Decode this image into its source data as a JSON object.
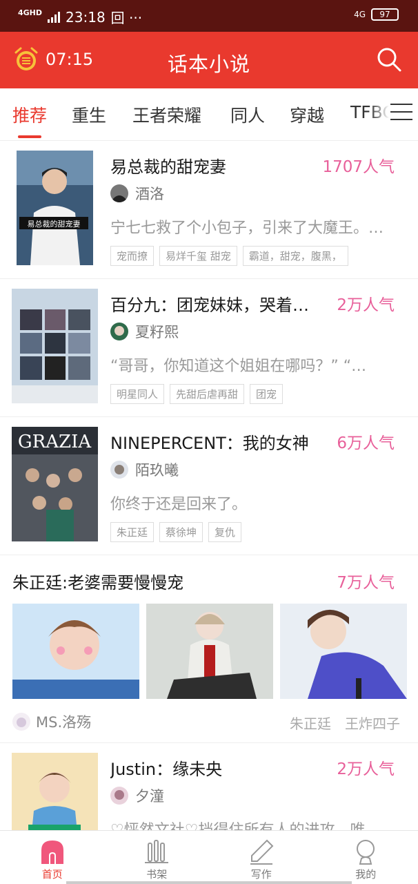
{
  "status_bar": {
    "network_type": "4GHD",
    "time": "23:18",
    "extra_icons": "回 ···",
    "signal_right": "4G",
    "battery": "97"
  },
  "header": {
    "alarm_time": "07:15",
    "title": "话本小说",
    "accent_color": "#e9392e"
  },
  "tabs": [
    {
      "label": "推荐",
      "active": true
    },
    {
      "label": "重生",
      "active": false
    },
    {
      "label": "王者荣耀",
      "active": false
    },
    {
      "label": "同人",
      "active": false
    },
    {
      "label": "穿越",
      "active": false
    },
    {
      "label": "TFBOYS",
      "active": false
    }
  ],
  "feed": {
    "books": [
      {
        "title": "易总裁的甜宠妻",
        "popularity": "1707人气",
        "author": "酒洛",
        "description": "宁七七救了个小包子，引来了大魔王。…",
        "tags": [
          "宠而撩",
          "易烊千玺  甜宠",
          "霸道，甜宠，腹黑，"
        ],
        "cover_caption": "易总裁的甜宠妻"
      },
      {
        "title": "百分九：团宠妹妹，哭着…",
        "popularity": "2万人气",
        "author": "夏籽熙",
        "description": "“哥哥，你知道这个姐姐在哪吗？” “…",
        "tags": [
          "明星同人",
          "先甜后虐再甜",
          "团宠"
        ],
        "cover_caption": ""
      },
      {
        "title": "NINEPERCENT：我的女神",
        "popularity": "6万人气",
        "author": "陌玖曦",
        "description": "你终于还是回来了。",
        "tags": [
          "朱正廷",
          "蔡徐坤",
          "复仇"
        ],
        "cover_caption": "GRAZIA"
      }
    ],
    "gallery": {
      "title": "朱正廷:老婆需要慢慢宠",
      "popularity": "7万人气",
      "author": "MS.洛殇",
      "tags": [
        "朱正廷",
        "王炸四子"
      ]
    },
    "last_book": {
      "title": "Justin：缘未央",
      "popularity": "2万人气",
      "author": "夕潼",
      "description": "♡怦然文社♡挡得住所有人的进攻，唯…"
    }
  },
  "bottom_nav": [
    {
      "label": "首页",
      "icon": "home-icon",
      "active": true
    },
    {
      "label": "书架",
      "icon": "bookshelf-icon",
      "active": false
    },
    {
      "label": "写作",
      "icon": "pen-icon",
      "active": false
    },
    {
      "label": "我的",
      "icon": "profile-icon",
      "active": false
    }
  ]
}
